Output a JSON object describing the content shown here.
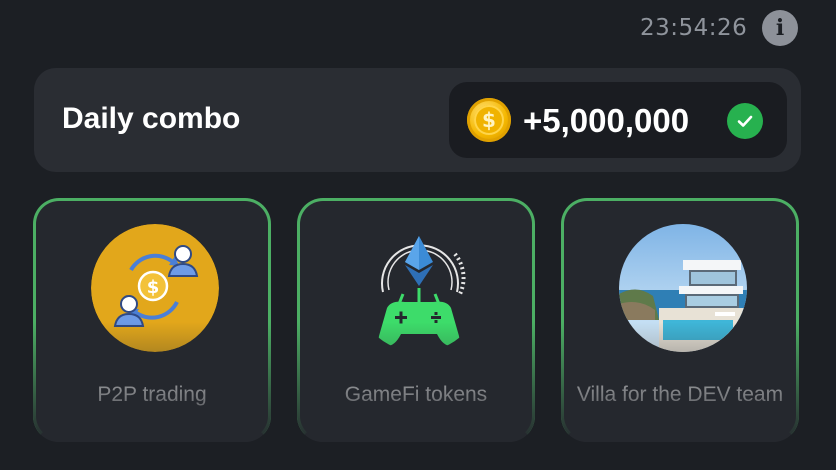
{
  "header": {
    "timer": "23:54:26",
    "info_icon": "info-icon"
  },
  "daily_combo": {
    "title": "Daily combo",
    "reward": "+5,000,000",
    "coin_icon": "dollar-coin-icon",
    "status_icon": "checkmark-icon",
    "status_color": "#27b14f",
    "coin_symbol": "$"
  },
  "cards": [
    {
      "label": "P2P trading",
      "icon": "p2p-exchange-icon"
    },
    {
      "label": "GameFi tokens",
      "icon": "gamefi-controller-icon"
    },
    {
      "label": "Villa for the DEV team",
      "icon": "villa-image"
    }
  ],
  "colors": {
    "background": "#1c1f24",
    "panel": "#2a2d33",
    "card_border": "#4caf64",
    "accent_green": "#3ddc6a",
    "coin_gold": "#f5b800"
  }
}
